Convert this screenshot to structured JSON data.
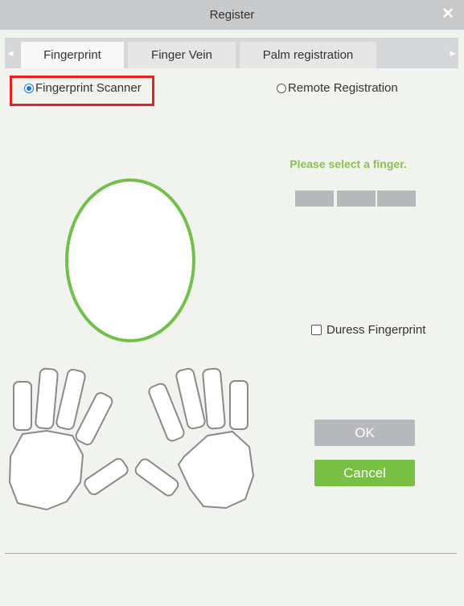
{
  "dialog": {
    "title": "Register",
    "close_icon": "close-icon"
  },
  "tabs": [
    {
      "label": "Fingerprint",
      "active": true
    },
    {
      "label": "Finger Vein",
      "active": false
    },
    {
      "label": "Palm registration",
      "active": false
    }
  ],
  "mode": {
    "options": [
      {
        "label": "Fingerprint Scanner",
        "selected": true
      },
      {
        "label": "Remote Registration",
        "selected": false
      }
    ]
  },
  "prompt": "Please select a finger.",
  "enrollment": {
    "segments_total": 3,
    "segments_done": 0
  },
  "duress": {
    "label": "Duress Fingerprint",
    "checked": false
  },
  "buttons": {
    "ok": "OK",
    "cancel": "Cancel"
  },
  "colors": {
    "accent_green": "#78c043",
    "prompt_green": "#8cc152",
    "highlight_red": "#e8201e",
    "disabled_gray": "#b7b9bc"
  }
}
